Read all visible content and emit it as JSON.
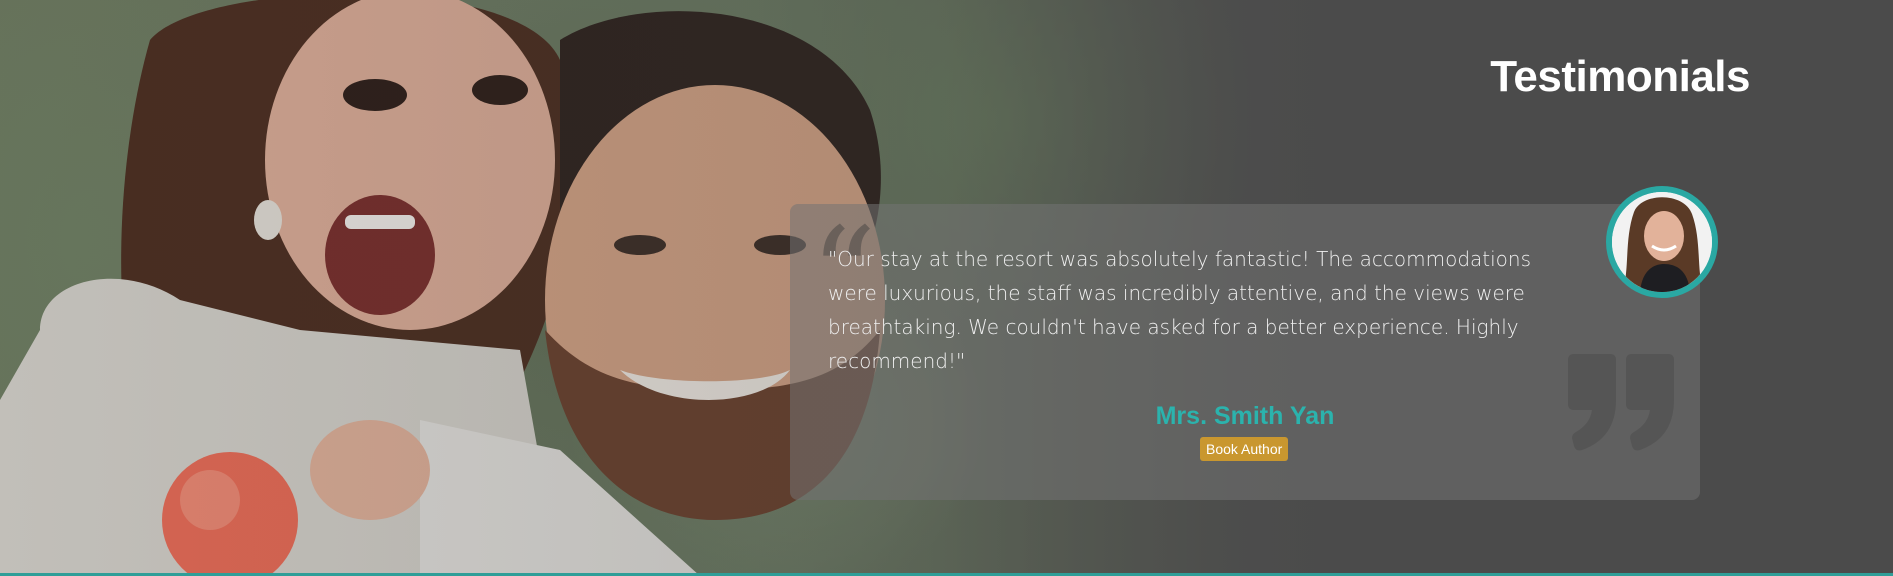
{
  "section": {
    "title": "Testimonials"
  },
  "testimonial": {
    "quote": "\"Our stay at the resort was absolutely fantastic! The accommodations were luxurious, the staff was incredibly attentive, and the views were breathtaking. We couldn't have asked for a better experience. Highly recommend!\"",
    "author_name": "Mrs. Smith Yan",
    "author_role": "Book Author"
  },
  "icons": {
    "open_quote": "quote-open-icon",
    "close_quote": "quote-close-icon"
  },
  "colors": {
    "accent": "#2bb3ad",
    "badge": "#c9972f",
    "background": "#4b4b4b"
  }
}
